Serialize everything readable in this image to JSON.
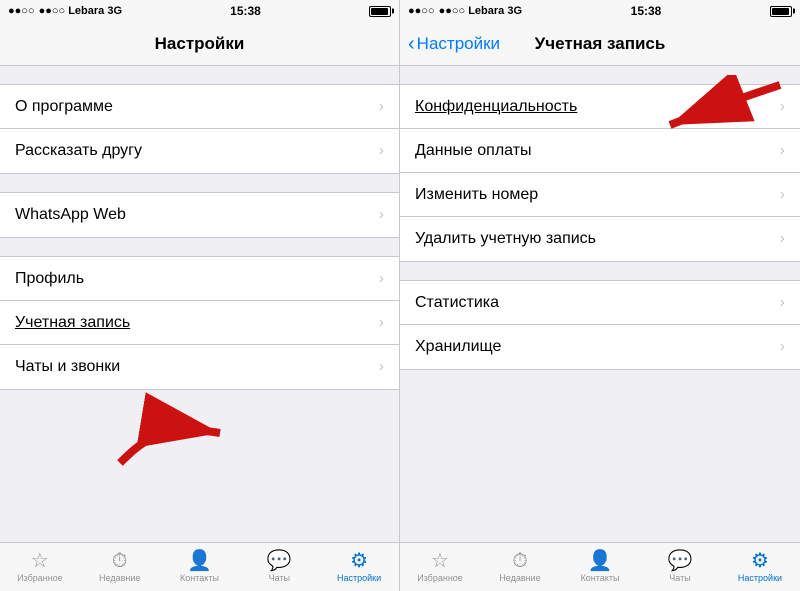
{
  "left_panel": {
    "status_bar": {
      "carrier": "●●○○ Lebara  3G",
      "time": "15:38"
    },
    "nav": {
      "title": "Настройки"
    },
    "sections": [
      {
        "items": [
          {
            "label": "О программе",
            "id": "about"
          },
          {
            "label": "Рассказать другу",
            "id": "tell-friend"
          }
        ]
      },
      {
        "items": [
          {
            "label": "WhatsApp Web",
            "id": "whatsapp-web"
          }
        ]
      },
      {
        "items": [
          {
            "label": "Профиль",
            "id": "profile"
          },
          {
            "label": "Учетная запись",
            "id": "account",
            "underline": true
          },
          {
            "label": "Чаты и звонки",
            "id": "chats-calls"
          }
        ]
      }
    ],
    "tabs": [
      {
        "icon": "☆",
        "label": "Избранное",
        "active": false
      },
      {
        "icon": "🕐",
        "label": "Недавние",
        "active": false
      },
      {
        "icon": "👤",
        "label": "Контакты",
        "active": false
      },
      {
        "icon": "💬",
        "label": "Чаты",
        "active": false
      },
      {
        "icon": "⚙",
        "label": "Настройки",
        "active": true
      }
    ]
  },
  "right_panel": {
    "status_bar": {
      "carrier": "●●○○ Lebara  3G",
      "time": "15:38"
    },
    "nav": {
      "back_label": "Настройки",
      "title": "Учетная запись"
    },
    "sections": [
      {
        "items": [
          {
            "label": "Конфиденциальность",
            "id": "privacy",
            "underline": true
          },
          {
            "label": "Данные оплаты",
            "id": "payment"
          },
          {
            "label": "Изменить номер",
            "id": "change-number"
          },
          {
            "label": "Удалить учетную запись",
            "id": "delete-account"
          }
        ]
      },
      {
        "items": [
          {
            "label": "Статистика",
            "id": "statistics"
          },
          {
            "label": "Хранилище",
            "id": "storage"
          }
        ]
      }
    ],
    "tabs": [
      {
        "icon": "☆",
        "label": "Избранное",
        "active": false
      },
      {
        "icon": "🕐",
        "label": "Недавние",
        "active": false
      },
      {
        "icon": "👤",
        "label": "Контакты",
        "active": false
      },
      {
        "icon": "💬",
        "label": "Чаты",
        "active": false
      },
      {
        "icon": "⚙",
        "label": "Настройки",
        "active": true
      }
    ]
  },
  "chevron": "›",
  "colors": {
    "accent": "#007aff",
    "active_tab": "#0070c9",
    "arrow_red": "#cc1111"
  }
}
